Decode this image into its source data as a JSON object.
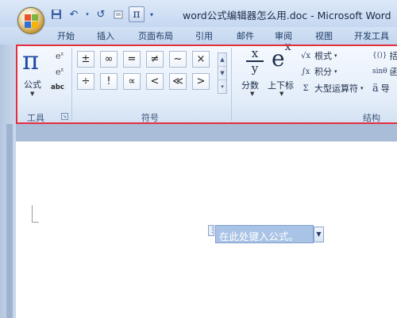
{
  "window": {
    "title": "word公式编辑器怎么用.doc - Microsoft Word"
  },
  "quick_access": {
    "save_icon": "save-icon",
    "undo_icon": "undo-icon",
    "undo_glyph": "↶",
    "redo_glyph": "↺",
    "pi_glyph": "π"
  },
  "tabs": [
    {
      "label": "开始"
    },
    {
      "label": "插入"
    },
    {
      "label": "页面布局"
    },
    {
      "label": "引用"
    },
    {
      "label": "邮件"
    },
    {
      "label": "审阅"
    },
    {
      "label": "视图"
    },
    {
      "label": "开发工具"
    }
  ],
  "ribbon": {
    "tools_group": {
      "label": "工具",
      "formula_label": "公式",
      "formula_glyph": "π",
      "abc_label": "abc",
      "e_glyph_1": "e",
      "e_glyph_2": "e"
    },
    "symbols_group": {
      "label": "符号",
      "symbols": [
        "±",
        "∞",
        "=",
        "≠",
        "~",
        "×",
        "÷",
        "!",
        "∝",
        "<",
        "≪",
        ">"
      ]
    },
    "structures_group": {
      "label": "结构",
      "fraction_label": "分数",
      "script_label": "上下标",
      "radical_label": "根式",
      "integral_label": "积分",
      "large_operator_label": "大型运算符",
      "bracket_label_partial": "括",
      "function_label_partial": "函",
      "accent_label_partial": "导"
    }
  },
  "document": {
    "equation_placeholder": "在此处键入公式。"
  },
  "colors": {
    "highlight_outline": "#e52f3d",
    "equation_box": "#a9c3e6"
  }
}
